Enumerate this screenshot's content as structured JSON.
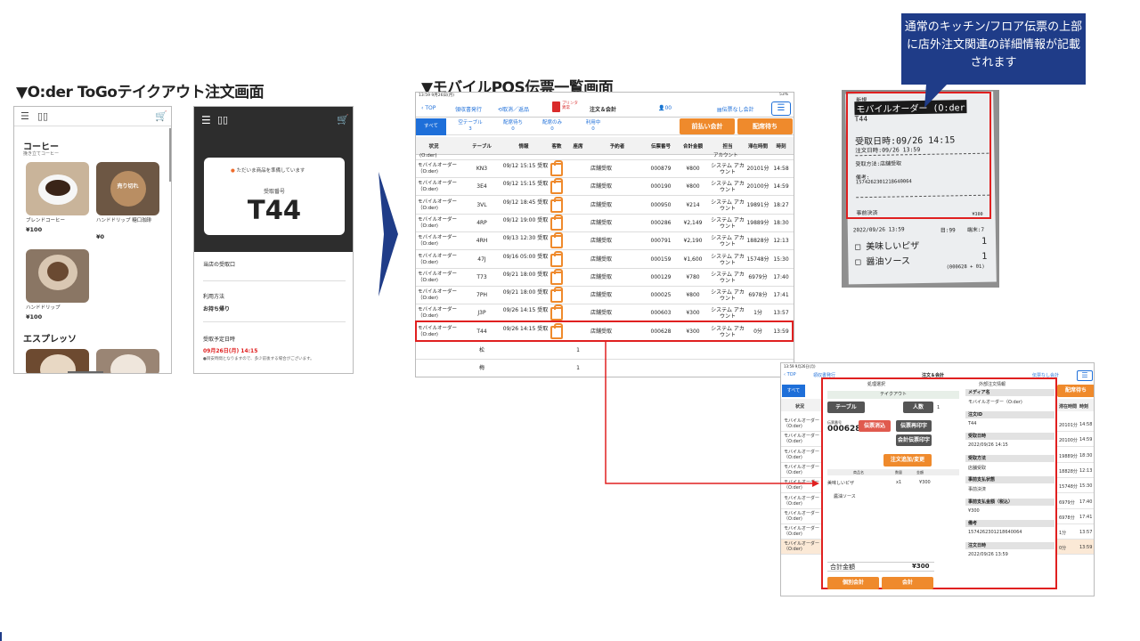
{
  "titles": {
    "oder": "▼O:der ToGoテイクアウト注文画面",
    "pos": "▼モバイルPOS伝票一覧画面"
  },
  "callout": "通常のキッチン/フロア伝票の上部に店外注文関連の詳細情報が記載されます",
  "phone1": {
    "cat1": "コーヒー",
    "cat1_sub": "挽き立てコーヒー",
    "items": [
      {
        "name": "ブレンドコーヒー",
        "price": "¥100"
      },
      {
        "name": "ハンドドリップ 糖口珈琲",
        "price": "¥0",
        "badge": "売り切れ"
      },
      {
        "name": "ハンドドリップ",
        "price": "¥100"
      }
    ],
    "cat2": "エスプレッソ"
  },
  "phone2": {
    "status": "ただいま商品を準備しています",
    "receive_label": "受取番号",
    "receive_no": "T44",
    "row1": "当店の受取口",
    "row2_label": "利用方法",
    "row2_value": "お持ち帰り",
    "row3_label": "受取予定日時",
    "row3_value": "09月26日(月) 14:15",
    "row3_note": "●目安時間となりますので、多少前後する場合がございます。"
  },
  "pos": {
    "status_time": "13:59  9月26日(月)",
    "status_batt": "53%",
    "nav": {
      "top": "TOP",
      "receipt": "領収書発行",
      "cancel": "取消／返品",
      "printer": "プリンタ\n異常",
      "title": "注文＆会計",
      "user": "00",
      "no_slip": "伝票なし会計"
    },
    "tabs": [
      {
        "label": "すべて",
        "count": ""
      },
      {
        "label": "空テーブル",
        "count": "3"
      },
      {
        "label": "配席待ち",
        "count": "0"
      },
      {
        "label": "配席のみ",
        "count": "0"
      },
      {
        "label": "利用中",
        "count": "0"
      }
    ],
    "btn_prepay": "前払い会計",
    "btn_seat": "配席待ち",
    "headers": [
      "状況",
      "テーブル",
      "情報",
      "客数",
      "座席",
      "予約者",
      "伝票番号",
      "合計金額",
      "担当",
      "滞在時間",
      "時刻"
    ],
    "partial_status": "(O:der)",
    "partial_staff": "アカウント",
    "rows": [
      {
        "status": "モバイルオーダー（O:der)",
        "table": "KN3",
        "info": "09/12 15:15 受取",
        "reserver": "店舗受取",
        "slip": "000879",
        "total": "¥800",
        "staff": "システム アカウント",
        "stay": "20101分",
        "time": "14:58"
      },
      {
        "status": "モバイルオーダー（O:der)",
        "table": "3E4",
        "info": "09/12 15:15 受取",
        "reserver": "店舗受取",
        "slip": "000190",
        "total": "¥800",
        "staff": "システム アカウント",
        "stay": "20100分",
        "time": "14:59"
      },
      {
        "status": "モバイルオーダー（O:der)",
        "table": "3VL",
        "info": "09/12 18:45 受取",
        "reserver": "店舗受取",
        "slip": "000950",
        "total": "¥214",
        "staff": "システム アカウント",
        "stay": "19891分",
        "time": "18:27"
      },
      {
        "status": "モバイルオーダー（O:der)",
        "table": "4RP",
        "info": "09/12 19:00 受取",
        "reserver": "店舗受取",
        "slip": "000286",
        "total": "¥2,149",
        "staff": "システム アカウント",
        "stay": "19889分",
        "time": "18:30"
      },
      {
        "status": "モバイルオーダー（O:der)",
        "table": "4RH",
        "info": "09/13 12:30 受取",
        "reserver": "店舗受取",
        "slip": "000791",
        "total": "¥2,190",
        "staff": "システム アカウント",
        "stay": "18828分",
        "time": "12:13"
      },
      {
        "status": "モバイルオーダー（O:der)",
        "table": "47J",
        "info": "09/16 05:00 受取",
        "reserver": "店舗受取",
        "slip": "000159",
        "total": "¥1,600",
        "staff": "システム アカウント",
        "stay": "15748分",
        "time": "15:30"
      },
      {
        "status": "モバイルオーダー（O:der)",
        "table": "T73",
        "info": "09/21 18:00 受取",
        "reserver": "店舗受取",
        "slip": "000129",
        "total": "¥780",
        "staff": "システム アカウント",
        "stay": "6979分",
        "time": "17:40"
      },
      {
        "status": "モバイルオーダー（O:der)",
        "table": "7PH",
        "info": "09/21 18:00 受取",
        "reserver": "店舗受取",
        "slip": "000025",
        "total": "¥800",
        "staff": "システム アカウント",
        "stay": "6978分",
        "time": "17:41"
      },
      {
        "status": "モバイルオーダー（O:der)",
        "table": "J3P",
        "info": "09/26 14:15 受取",
        "reserver": "店舗受取",
        "slip": "000603",
        "total": "¥300",
        "staff": "システム アカウント",
        "stay": "1分",
        "time": "13:57"
      },
      {
        "status": "モバイルオーダー（O:der)",
        "table": "T44",
        "info": "09/26 14:15 受取",
        "reserver": "店舗受取",
        "slip": "000628",
        "total": "¥300",
        "staff": "システム アカウント",
        "stay": "0分",
        "time": "13:59"
      }
    ],
    "extra_rows": [
      {
        "table": "松",
        "seats": "1"
      },
      {
        "table": "梅",
        "seats": "1"
      }
    ]
  },
  "receipt": {
    "badge": "新規",
    "head": "モバイルオーダー (O:der",
    "code": "T44",
    "date_big": "受取日時:09/26 14:15",
    "order_time": "注文日時:09/26 13:59",
    "method": "受取方法:店舗受取",
    "note_label": "備考:",
    "note_value": "15742623012186400​64",
    "paid": "事前決済",
    "paid_amount": "¥300",
    "line2_date": "2022/09/26 13:59",
    "line2_seat": "目:99",
    "line2_term": "端末:7",
    "item1": "美味しいピザ",
    "item1_qty": "1",
    "item2": "醤油ソース",
    "item2_qty": "1",
    "footer": "(000628 + 01)"
  },
  "detail": {
    "status_time": "13:59  9月26日(月)",
    "left_title": "処理選択",
    "right_title": "外部注文情報",
    "takeout": "テイクアウト",
    "table_btn": "テーブル",
    "people_btn": "人数",
    "people_val": "1",
    "slip_label": "伝票番号",
    "slip_no": "000628",
    "btn_cancel": "伝票消込",
    "btn_reprint": "伝票再印字",
    "btn_bill": "会計伝票印字",
    "btn_add": "注文追加/変更",
    "col_name": "商品名",
    "col_qty": "数量",
    "col_amount": "金額",
    "item1": "美味しいピザ",
    "item1_qty": "x1",
    "item1_amount": "¥300",
    "item2": "醤油ソース",
    "total_label": "合計金額",
    "total_value": "¥300",
    "btn_split": "個別会計",
    "btn_pay": "会計",
    "info": [
      {
        "k": "メディア名",
        "v": "モバイルオーダー（O:der)"
      },
      {
        "k": "注文ID",
        "v": "T44"
      },
      {
        "k": "受取日時",
        "v": "2022/09/26 14:15"
      },
      {
        "k": "受取方法",
        "v": "店舗受取"
      },
      {
        "k": "事前支払状態",
        "v": "事前決済"
      },
      {
        "k": "事前支払金額（税込）",
        "v": "¥300"
      },
      {
        "k": "備考",
        "v": "1574262301218640064"
      },
      {
        "k": "注文日時",
        "v": "2022/09/26 13:59"
      }
    ],
    "bg_nav_top": "TOP",
    "bg_nav_receipt": "領収書発行",
    "bg_nav_title": "注文＆会計",
    "bg_nav_noslip": "伝票なし会計",
    "bg_tab_all": "すべて",
    "bg_btn_seat": "配席待ち",
    "bg_status_head": "状況",
    "bg_time_head": "時刻",
    "bg_stay_head": "滞在時間",
    "bg_rows": [
      {
        "s": "モバイルオーダー（O:der)",
        "stay": "20101分",
        "t": "14:58"
      },
      {
        "s": "モバイルオーダー（O:der)",
        "stay": "20100分",
        "t": "14:59"
      },
      {
        "s": "モバイルオーダー（O:der)",
        "stay": "19889分",
        "t": "18:30"
      },
      {
        "s": "モバイルオーダー（O:der)",
        "stay": "18828分",
        "t": "12:13"
      },
      {
        "s": "モバイルオーダー（O:der)",
        "stay": "15748分",
        "t": "15:30"
      },
      {
        "s": "モバイルオーダー（O:der)",
        "stay": "6979分",
        "t": "17:40"
      },
      {
        "s": "モバイルオーダー（O:der)",
        "stay": "6978分",
        "t": "17:41"
      },
      {
        "s": "モバイルオーダー（O:der)",
        "stay": "1分",
        "t": "13:57"
      },
      {
        "s": "モバイルオーダー（O:der)",
        "stay": "0分",
        "t": "13:59"
      }
    ]
  },
  "colors": {
    "accent": "#ef8a2c",
    "highlight": "#e02020",
    "link": "#1e6fd9",
    "callout": "#1f3c88"
  }
}
